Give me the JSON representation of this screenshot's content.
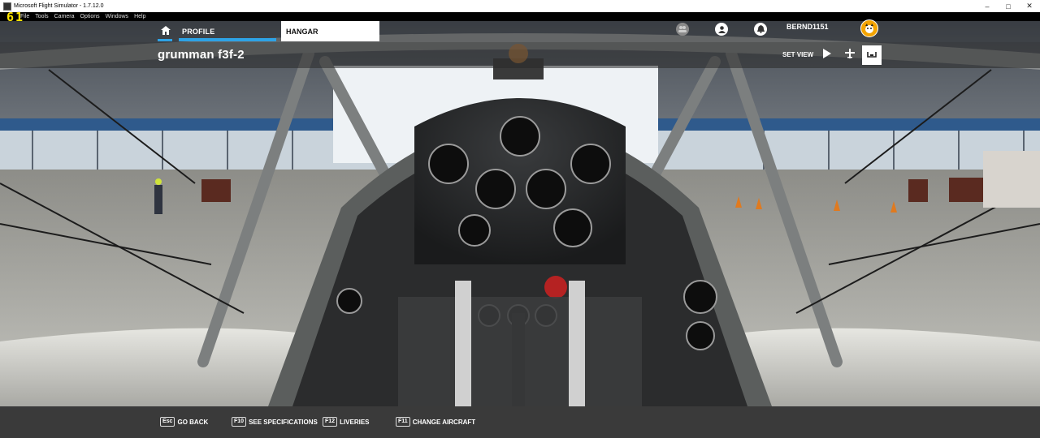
{
  "window": {
    "title": "Microsoft Flight Simulator - 1.7.12.0",
    "minimize": "–",
    "maximize": "□",
    "close": "✕"
  },
  "overlay": {
    "fps": "61"
  },
  "menubar": [
    "File",
    "Tools",
    "Camera",
    "Options",
    "Windows",
    "Help"
  ],
  "nav": {
    "profile_tab": "PROFILE",
    "hangar_tab": "HANGAR",
    "username": "BERND1151"
  },
  "header": {
    "aircraft_name": "grumman f3f-2",
    "set_view_label": "SET VIEW"
  },
  "footer": {
    "actions": [
      {
        "key": "Esc",
        "label": "GO BACK"
      },
      {
        "key": "F10",
        "label": "SEE SPECIFICATIONS"
      },
      {
        "key": "F12",
        "label": "LIVERIES"
      },
      {
        "key": "F11",
        "label": "CHANGE AIRCRAFT"
      }
    ]
  },
  "colors": {
    "accent": "#2ea3e6",
    "fps": "#ffe400",
    "avatar": "#f4a400"
  },
  "icons": [
    "home-icon",
    "group-icon",
    "user-icon",
    "notification-icon",
    "play-icon",
    "airplane-icon",
    "cockpit-view-icon"
  ]
}
